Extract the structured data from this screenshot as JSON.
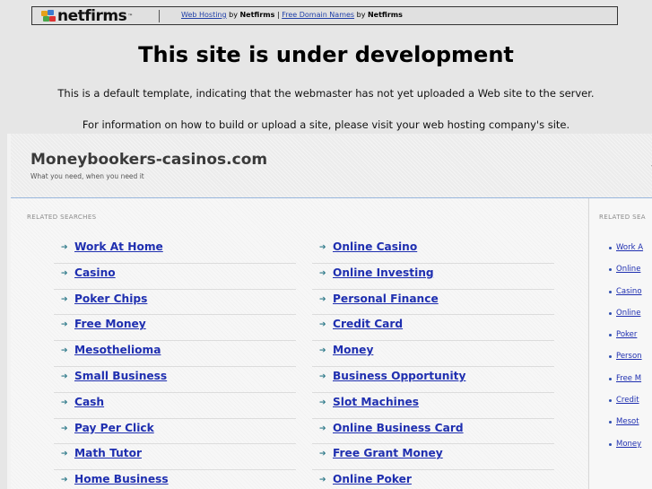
{
  "netfirms_bar": {
    "logo_text": "netfirms",
    "logo_tm": "™",
    "link_web_hosting": "Web Hosting",
    "by_1": "by",
    "brand_1": "Netfirms",
    "divider": "|",
    "link_free_domain_names": "Free Domain Names",
    "by_2": "by",
    "brand_2": "Netfirms"
  },
  "dev_notice": {
    "title": "This site is under development",
    "line1": "This is a default template, indicating that the webmaster has not yet uploaded a Web site to the server.",
    "line2": "For information on how to build or upload a site, please visit your web hosting company's site."
  },
  "parked_page": {
    "site_title": "Moneybookers-casinos.com",
    "tagline": "What you need, when you need it",
    "header_glyph": "-",
    "related_heading": "RELATED SEARCHES",
    "related_heading_side": "RELATED SEA",
    "left_keywords": [
      "Work At Home",
      "Casino",
      "Poker Chips",
      "Free Money",
      "Mesothelioma",
      "Small Business",
      "Cash",
      "Pay Per Click",
      "Math Tutor",
      "Home Business"
    ],
    "right_keywords": [
      "Online Casino",
      "Online Investing",
      "Personal Finance",
      "Credit Card",
      "Money",
      "Business Opportunity",
      "Slot Machines",
      "Online Business Card",
      "Free Grant Money",
      "Online Poker"
    ],
    "side_keywords": [
      "Work A",
      "Online",
      "Casino",
      "Online",
      "Poker",
      "Person",
      "Free M",
      "Credit",
      "Mesot",
      "Money"
    ],
    "arrow_glyph": "➔"
  },
  "colors": {
    "page_background": "#e6e6e6",
    "link_blue": "#1f2fb0",
    "arrow_teal": "#2f7a8a",
    "header_border": "#98b6dc"
  }
}
